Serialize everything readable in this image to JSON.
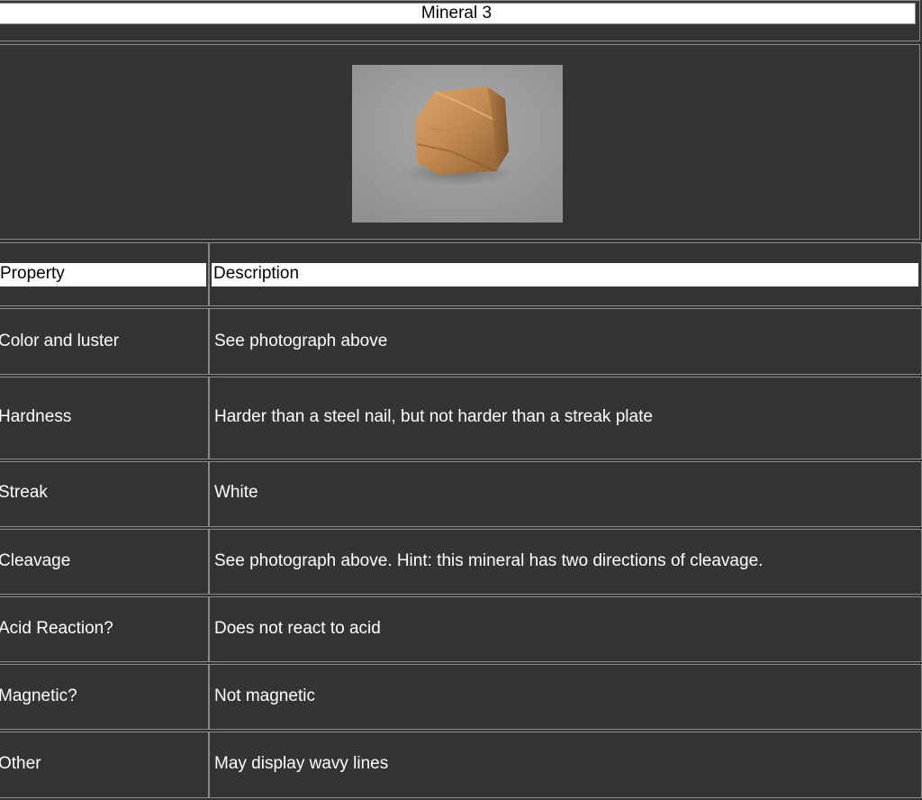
{
  "title": "Mineral 3",
  "photo": {
    "alt": "Mineral 3 specimen photograph"
  },
  "table": {
    "headers": {
      "property": "Property",
      "description": "Description"
    },
    "rows": [
      {
        "property": "Color and luster",
        "description": "See photograph above"
      },
      {
        "property": "Hardness",
        "description": "Harder than a steel nail, but not harder than a streak plate"
      },
      {
        "property": "Streak",
        "description": "White"
      },
      {
        "property": "Cleavage",
        "description": "See photograph above. Hint: this mineral has two directions of cleavage."
      },
      {
        "property": "Acid Reaction?",
        "description": "Does not react to acid"
      },
      {
        "property": "Magnetic?",
        "description": "Not magnetic"
      },
      {
        "property": "Other",
        "description": "May display wavy lines"
      }
    ]
  }
}
